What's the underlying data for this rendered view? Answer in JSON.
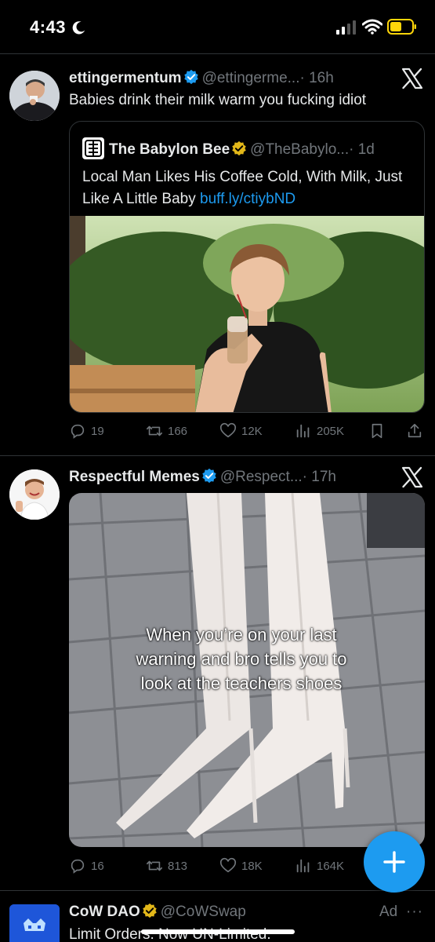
{
  "status_bar": {
    "time": "4:43",
    "icons": [
      "moon-icon",
      "signal-icon",
      "wifi-icon",
      "battery-icon"
    ]
  },
  "tweets": [
    {
      "author": "ettingermentum",
      "handle": "@ettingerme...",
      "time": "· 16h",
      "text": "Babies drink their milk warm you fucking idiot",
      "quote": {
        "author": "The Babylon Bee",
        "handle": "@TheBabylo...",
        "time": "· 1d",
        "text": "Local Man Likes His Coffee Cold, With Milk, Just Like A Little Baby",
        "link": "buff.ly/ctiybND"
      },
      "stats": {
        "replies": "19",
        "reposts": "166",
        "likes": "12K",
        "views": "205K"
      }
    },
    {
      "author": "Respectful Memes",
      "handle": "@Respect...",
      "time": "· 17h",
      "caption": "When you’re on your last warning and bro tells you to look at the teachers shoes",
      "stats": {
        "replies": "16",
        "reposts": "813",
        "likes": "18K",
        "views": "164K"
      }
    },
    {
      "author": "CoW DAO",
      "handle": "@CoWSwap",
      "ad_label": "Ad",
      "more": "···",
      "text": "Limit Orders. Now UN-Limited."
    }
  ],
  "colors": {
    "background": "#000000",
    "accent": "#1d9bf0",
    "muted": "#71767b",
    "gold_badge": "#e2b719"
  }
}
